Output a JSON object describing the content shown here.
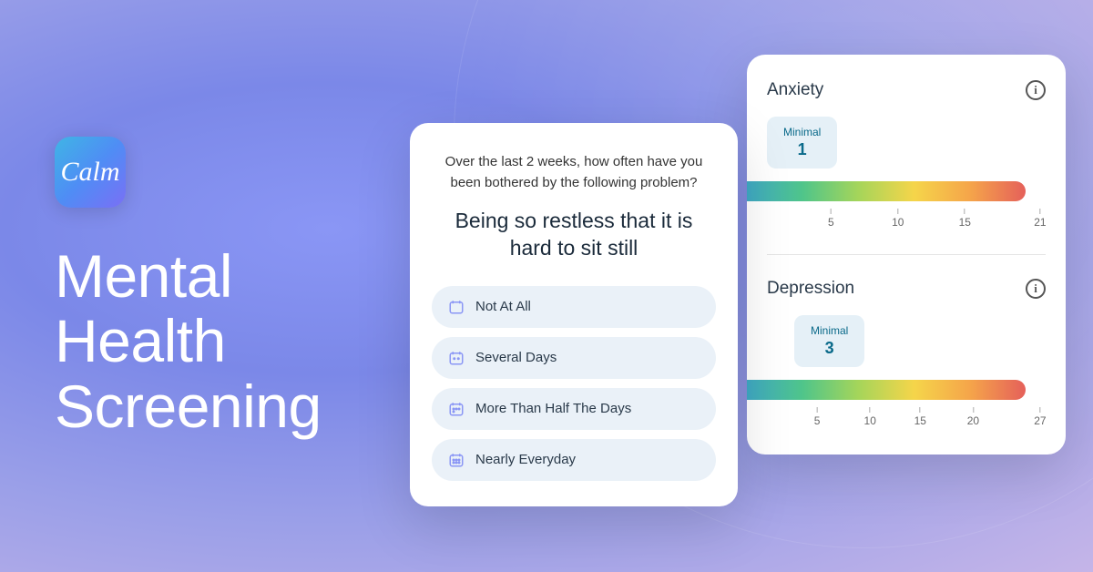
{
  "hero": {
    "app_name": "Calm",
    "title_line1": "Mental",
    "title_line2": "Health",
    "title_line3": "Screening"
  },
  "question": {
    "intro": "Over the last 2 weeks, how often have you been bothered by the following problem?",
    "prompt": "Being so restless that it is hard to sit still",
    "options": [
      {
        "label": "Not At All"
      },
      {
        "label": "Several Days"
      },
      {
        "label": "More Than Half The Days"
      },
      {
        "label": "Nearly Everyday"
      }
    ]
  },
  "results": {
    "anxiety": {
      "title": "Anxiety",
      "badge_label": "Minimal",
      "badge_value": "1",
      "ticks": [
        {
          "pos": 23,
          "label": "5"
        },
        {
          "pos": 47,
          "label": "10"
        },
        {
          "pos": 71,
          "label": "15"
        },
        {
          "pos": 98,
          "label": "21"
        }
      ]
    },
    "depression": {
      "title": "Depression",
      "badge_label": "Minimal",
      "badge_value": "3",
      "ticks": [
        {
          "pos": 18,
          "label": "5"
        },
        {
          "pos": 37,
          "label": "10"
        },
        {
          "pos": 55,
          "label": "15"
        },
        {
          "pos": 74,
          "label": "20"
        },
        {
          "pos": 98,
          "label": "27"
        }
      ]
    }
  }
}
